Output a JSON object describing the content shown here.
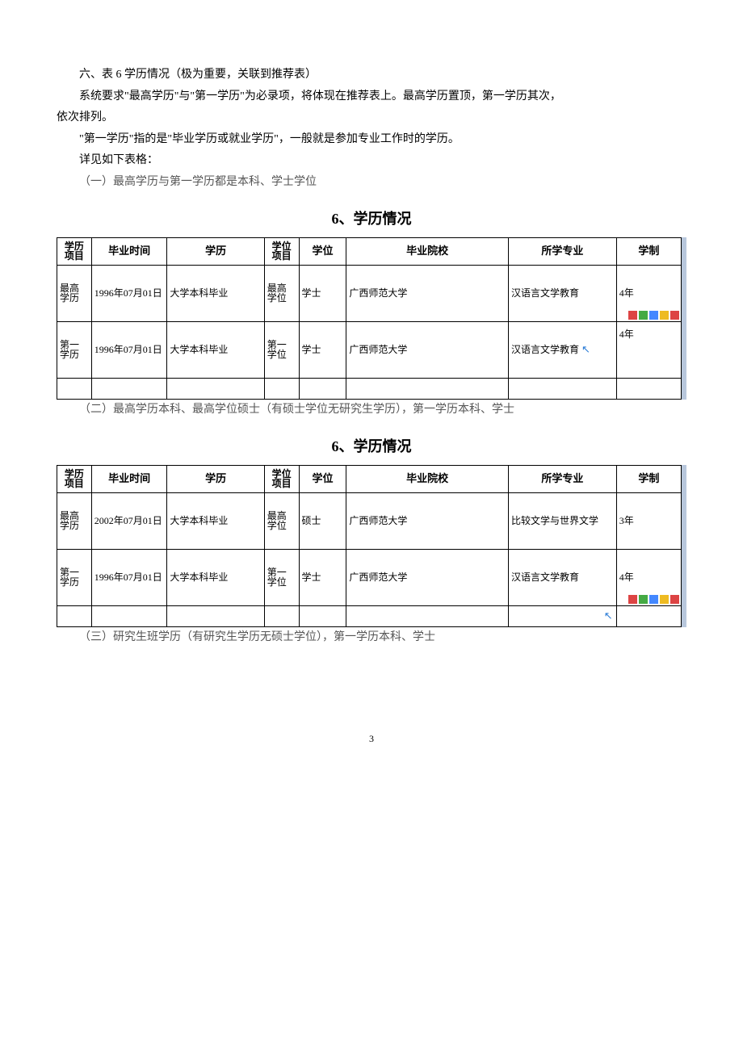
{
  "intro": {
    "p1": "六、表 6 学历情况（极为重要，关联到推荐表）",
    "p2": "系统要求\"最高学历\"与\"第一学历\"为必录项，将体现在推荐表上。最高学历置顶，第一学历其次，",
    "p2b": "依次排列。",
    "p3": "\"第一学历\"指的是\"毕业学历或就业学历\"，一般就是参加专业工作时的学历。",
    "p4": "详见如下表格：",
    "s1": "（一）最高学历与第一学历都是本科、学士学位"
  },
  "table1": {
    "title": "6、学历情况",
    "headers": {
      "eduItem": "学历项目",
      "gradTime": "毕业时间",
      "education": "学历",
      "degreeItem": "学位项目",
      "degree": "学位",
      "school": "毕业院校",
      "major": "所学专业",
      "system": "学制"
    },
    "rows": [
      {
        "eduItem": "最高学历",
        "time": "1996年07月01日",
        "edu": "大学本科毕业",
        "degItem": "最高学位",
        "degree": "学士",
        "school": "广西师范大学",
        "major": "汉语言文学教育",
        "system": "4年",
        "icons": true
      },
      {
        "eduItem": "第一学历",
        "time": "1996年07月01日",
        "edu": "大学本科毕业",
        "degItem": "第一学位",
        "degree": "学士",
        "school": "广西师范大学",
        "major": "汉语言文学教育",
        "system": "4年",
        "cursor": true
      }
    ]
  },
  "mid": {
    "s2": "（二）最高学历本科、最高学位硕士（有硕士学位无研究生学历），第一学历本科、学士"
  },
  "table2": {
    "title": "6、学历情况",
    "headers": {
      "eduItem": "学历项目",
      "gradTime": "毕业时间",
      "education": "学历",
      "degreeItem": "学位项目",
      "degree": "学位",
      "school": "毕业院校",
      "major": "所学专业",
      "system": "学制"
    },
    "rows": [
      {
        "eduItem": "最高学历",
        "time": "2002年07月01日",
        "edu": "大学本科毕业",
        "degItem": "最高学位",
        "degree": "硕士",
        "school": "广西师范大学",
        "major": "比较文学与世界文学",
        "system": "3年"
      },
      {
        "eduItem": "第一学历",
        "time": "1996年07月01日",
        "edu": "大学本科毕业",
        "degItem": "第一学位",
        "degree": "学士",
        "school": "广西师范大学",
        "major": "汉语言文学教育",
        "system": "4年",
        "icons": true
      }
    ]
  },
  "end": {
    "s3": "（三）研究生班学历（有研究生学历无硕士学位），第一学历本科、学士"
  },
  "pageNum": "3"
}
